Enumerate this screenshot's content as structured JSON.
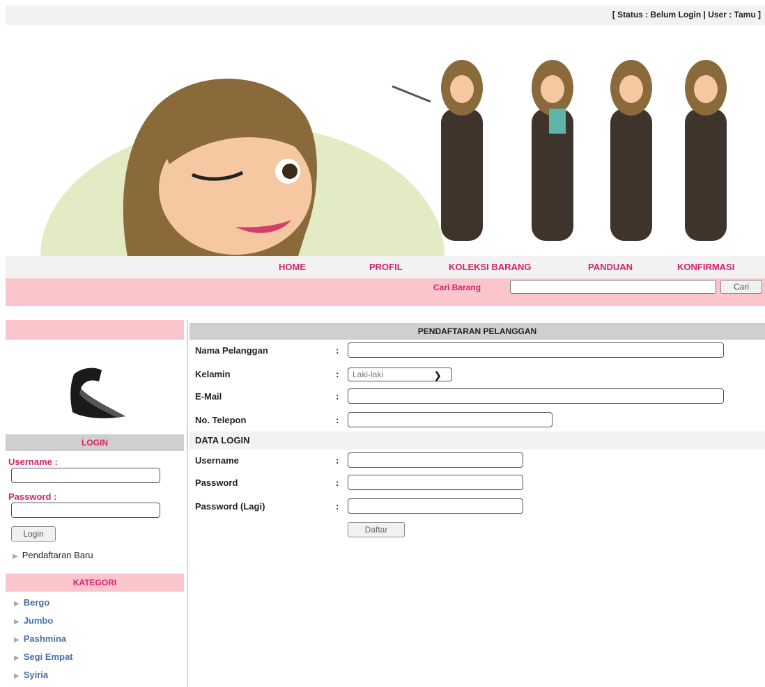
{
  "header": {
    "status_text": "[ Status : Belum Login | User : Tamu ]"
  },
  "nav": {
    "items": [
      "HOME",
      "PROFIL",
      "KOLEKSI BARANG",
      "PANDUAN",
      "KONFIRMASI"
    ]
  },
  "search": {
    "label": "Cari Barang",
    "value": "",
    "button": "Cari"
  },
  "sidebar": {
    "login_title": "LOGIN",
    "username_label": "Username :",
    "password_label": "Password :",
    "login_button": "Login",
    "register_link": "Pendaftaran Baru",
    "kategori_title": "KATEGORI",
    "kategori": [
      "Bergo",
      "Jumbo",
      "Pashmina",
      "Segi Empat",
      "Syiria"
    ]
  },
  "form": {
    "title": "PENDAFTARAN PELANGGAN",
    "labels": {
      "nama": "Nama Pelanggan",
      "kelamin": "Kelamin",
      "email": "E-Mail",
      "telepon": "No. Telepon",
      "username": "Username",
      "password": "Password",
      "password_lagi": "Password (Lagi)"
    },
    "colon": ":",
    "kelamin_value": "Laki-laki",
    "section_data_login": "DATA LOGIN",
    "submit": "Daftar"
  },
  "colors": {
    "accent": "#d6216b",
    "pink_band": "#fbc5cc",
    "header_grey": "#cfcfcf",
    "link_blue": "#4a6fa8"
  },
  "icons": {
    "select_arrow": "chevron-down-icon",
    "list_bullet": "arrow-right-icon"
  }
}
